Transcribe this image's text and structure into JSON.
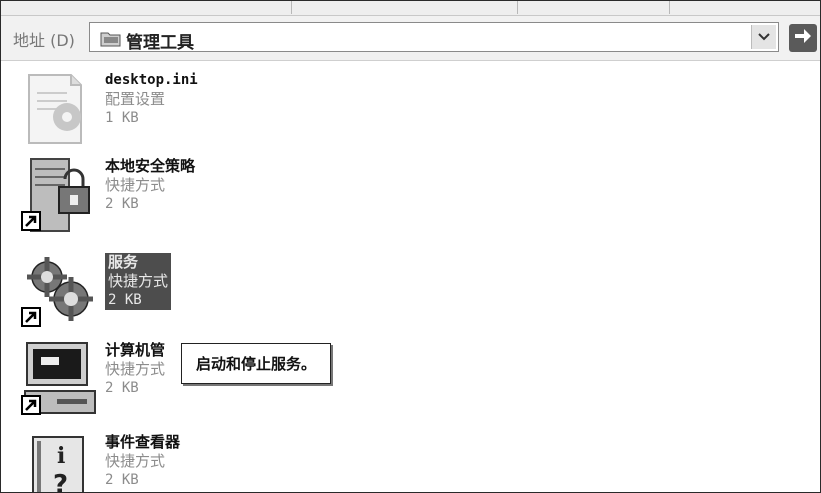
{
  "address_bar": {
    "label": "地址 (D)",
    "path": "管理工具"
  },
  "files": [
    {
      "name": "desktop.ini",
      "type": "配置设置",
      "size": "1 KB"
    },
    {
      "name": "本地安全策略",
      "type": "快捷方式",
      "size": "2 KB"
    },
    {
      "name": "服务",
      "type": "快捷方式",
      "size": "2 KB"
    },
    {
      "name": "计算机管",
      "type": "快捷方式",
      "size": "2 KB"
    },
    {
      "name": "事件查看器",
      "type": "快捷方式",
      "size": "2 KB"
    }
  ],
  "tooltip": {
    "text": "启动和停止服务。"
  },
  "icons": {
    "address_folder": "folder-icon",
    "dropdown": "chevron-down-icon",
    "go": "arrow-right-icon",
    "file_types": [
      "settings-file-icon",
      "security-policy-icon",
      "services-gears-icon",
      "computer-management-icon",
      "event-viewer-icon"
    ],
    "shortcut": "shortcut-arrow-icon"
  },
  "colors": {
    "selection": "#4d4d4d",
    "muted_text": "#8c8c8c"
  }
}
